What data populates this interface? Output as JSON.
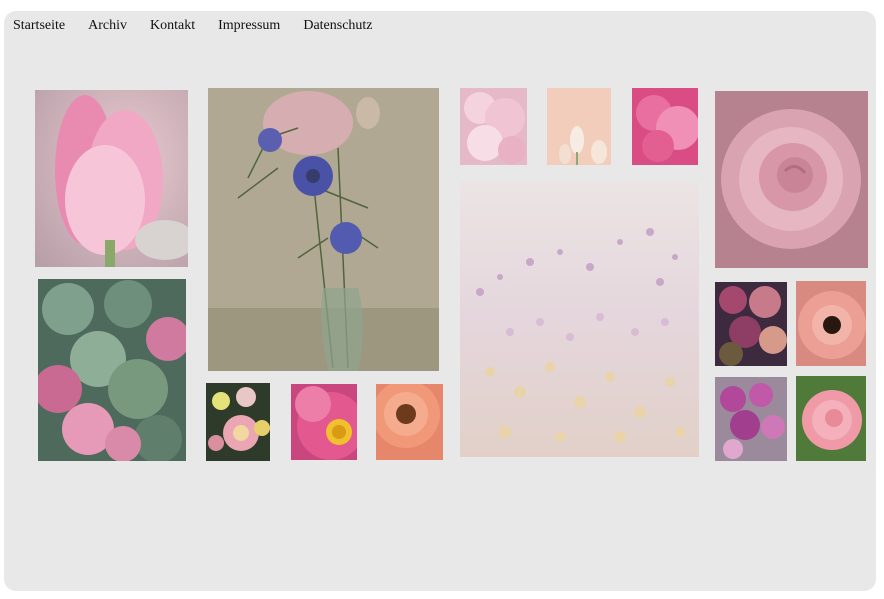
{
  "nav": {
    "items": [
      "Startseite",
      "Archiv",
      "Kontakt",
      "Impressum",
      "Datenschutz"
    ]
  },
  "gallery": {
    "images": [
      {
        "name": "tulip-photo",
        "subject": "pink tulip"
      },
      {
        "name": "hydrangea-photo",
        "subject": "hydrangea leaves"
      },
      {
        "name": "nigella-vase-photo",
        "subject": "nigella flowers in glass vase"
      },
      {
        "name": "bellis-photo",
        "subject": "bellis daisies"
      },
      {
        "name": "cosmos-photo",
        "subject": "pink cosmos"
      },
      {
        "name": "gerbera-orange-photo",
        "subject": "salmon gerbera"
      },
      {
        "name": "carnation-light-photo",
        "subject": "light pink carnation"
      },
      {
        "name": "tulip-bud-photo",
        "subject": "white tulip buds"
      },
      {
        "name": "carnation-pink-photo",
        "subject": "pink carnation"
      },
      {
        "name": "gypsophila-photo",
        "subject": "gypsophila field"
      },
      {
        "name": "rose-photo",
        "subject": "pink rose"
      },
      {
        "name": "hydrangea-dark-photo",
        "subject": "dark hydrangea"
      },
      {
        "name": "gerbera-pink-photo",
        "subject": "pink gerbera"
      },
      {
        "name": "orchid-photo",
        "subject": "purple orchids"
      },
      {
        "name": "camellia-photo",
        "subject": "pink camellia"
      }
    ]
  }
}
